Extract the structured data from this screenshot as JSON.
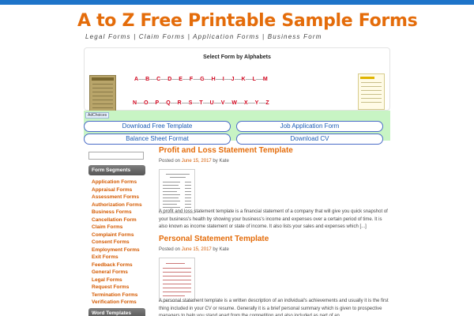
{
  "site": {
    "title": "A to Z Free Printable Sample Forms",
    "tagline": "Legal Forms | Claim Forms | Application Forms | Business Form"
  },
  "alphabet_panel": {
    "title": "Select Form by Alphabets",
    "row1": [
      "A",
      "B",
      "C",
      "D",
      "E",
      "F",
      "G",
      "H",
      "I",
      "J",
      "K",
      "L",
      "M"
    ],
    "row2": [
      "N",
      "O",
      "P",
      "Q",
      "R",
      "S",
      "T",
      "U",
      "V",
      "W",
      "X",
      "Y",
      "Z"
    ],
    "separator": "------"
  },
  "ads": {
    "adchoices": "AdChoices",
    "buttons": [
      "Download Free Template",
      "Job Application Form",
      "Balance Sheet Format",
      "Download CV"
    ]
  },
  "sidebar": {
    "segments_title": "Form Segments",
    "segments": [
      "Application Forms",
      "Appraisal Forms",
      "Assessment Forms",
      "Authorization Forms",
      "Business Forms",
      "Cancellation Form",
      "Claim Forms",
      "Complaint Forms",
      "Consent Forms",
      "Employment Forms",
      "Exit Forms",
      "Feedback Forms",
      "General Forms",
      "Legal Forms",
      "Request Forms",
      "Termination Forms",
      "Verification Forms"
    ],
    "word_templates_title": "Word Templates"
  },
  "posts": [
    {
      "title": "Profit and Loss Statement Template",
      "posted_on": "Posted on",
      "date": "June 15, 2017",
      "by": "by",
      "author": "Kate",
      "excerpt": "A profit and loss statement template is a financial statement of a company that will give you quick snapshot of your business's health by showing your business's income and expenses over a certain period of time. It is also known as income statement or state of income. It also lists your sales and expenses which [...]"
    },
    {
      "title": "Personal Statement Template",
      "posted_on": "Posted on",
      "date": "June 15, 2017",
      "by": "by",
      "author": "Kate",
      "excerpt": "A personal statement template is a written description of an individual's achievements and usually it is the first thing included in your CV or resume. Generally it is a brief personal summary which is given to prospective managers to help you stand apart from the competition and also included as part of an"
    }
  ]
}
